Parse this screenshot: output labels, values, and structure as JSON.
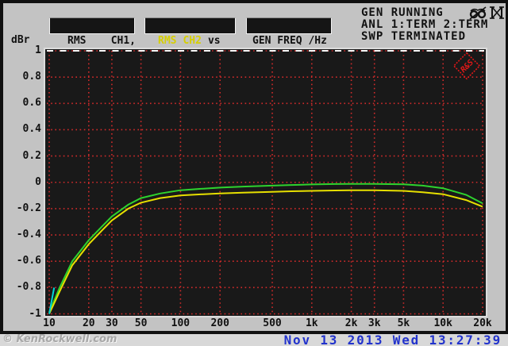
{
  "header": {
    "unit_label": "dBr",
    "meters": [
      {
        "quantity": "RMS",
        "channel": "CH1,"
      },
      {
        "quantity": "RMS",
        "channel": "CH2",
        "suffix": "vs"
      },
      {
        "label": "GEN FREQ /Hz"
      }
    ],
    "status_lines": [
      "GEN RUNNING",
      "ANL 1:TERM 2:TERM",
      "SWP TERMINATED"
    ]
  },
  "logo": {
    "text": "R&S"
  },
  "footer": {
    "watermark": "© KenRockwell.com",
    "timestamp": "Nov 13 2013 Wed 13:27:39"
  },
  "colors": {
    "ch1_trace": "#2ed32e",
    "ch2_trace": "#e6df00",
    "overlap_trace": "#00d8d8",
    "grid": "#d32b2b",
    "top_grid_dash": "#fafafa",
    "plot_bg": "#191919",
    "screen_bg": "#c3c3c3",
    "timestamp_blue": "#2233cc",
    "logo_red": "#e01818"
  },
  "chart_data": {
    "type": "line",
    "title": "",
    "xlabel": "GEN FREQ /Hz",
    "ylabel": "dBr",
    "x_scale": "log",
    "xlim": [
      10,
      20000
    ],
    "ylim": [
      -1,
      1
    ],
    "grid": "red dotted on black",
    "legend_position": "none",
    "y_ticks": [
      {
        "v": 1,
        "label": "1"
      },
      {
        "v": 0.8,
        "label": "0.8"
      },
      {
        "v": 0.6,
        "label": "0.6"
      },
      {
        "v": 0.4,
        "label": "0.4"
      },
      {
        "v": 0.2,
        "label": "0.2"
      },
      {
        "v": 0,
        "label": "0"
      },
      {
        "v": -0.2,
        "label": "-0.2"
      },
      {
        "v": -0.4,
        "label": "-0.4"
      },
      {
        "v": -0.6,
        "label": "-0.6"
      },
      {
        "v": -0.8,
        "label": "-0.8"
      },
      {
        "v": -1,
        "label": "-1"
      }
    ],
    "x_ticks": [
      {
        "f": 10,
        "label": "10"
      },
      {
        "f": 20,
        "label": "20"
      },
      {
        "f": 30,
        "label": "30"
      },
      {
        "f": 50,
        "label": "50"
      },
      {
        "f": 100,
        "label": "100"
      },
      {
        "f": 200,
        "label": "200"
      },
      {
        "f": 500,
        "label": "500"
      },
      {
        "f": 1000,
        "label": "1k"
      },
      {
        "f": 2000,
        "label": "2k"
      },
      {
        "f": 3000,
        "label": "3k"
      },
      {
        "f": 5000,
        "label": "5k"
      },
      {
        "f": 10000,
        "label": "10k"
      },
      {
        "f": 20000,
        "label": "20k"
      }
    ],
    "x": [
      10,
      12,
      15,
      20,
      25,
      30,
      40,
      50,
      70,
      100,
      150,
      200,
      300,
      500,
      700,
      1000,
      1500,
      2000,
      3000,
      5000,
      7000,
      10000,
      15000,
      20000
    ],
    "series": [
      {
        "name": "RMS CH1",
        "color": "#2ed32e",
        "y": [
          -0.99,
          -0.8,
          -0.6,
          -0.44,
          -0.34,
          -0.26,
          -0.17,
          -0.12,
          -0.085,
          -0.06,
          -0.048,
          -0.04,
          -0.032,
          -0.025,
          -0.02,
          -0.016,
          -0.013,
          -0.012,
          -0.012,
          -0.015,
          -0.025,
          -0.045,
          -0.095,
          -0.16
        ]
      },
      {
        "name": "RMS CH2",
        "color": "#e6df00",
        "y": [
          -1.0,
          -0.83,
          -0.63,
          -0.47,
          -0.37,
          -0.29,
          -0.2,
          -0.155,
          -0.12,
          -0.1,
          -0.09,
          -0.085,
          -0.078,
          -0.072,
          -0.068,
          -0.065,
          -0.062,
          -0.06,
          -0.06,
          -0.065,
          -0.075,
          -0.09,
          -0.135,
          -0.185
        ]
      },
      {
        "name": "trace-overlap-segment",
        "color": "#00d8d8",
        "x": [
          10,
          10.9
        ],
        "y": [
          -1.0,
          -0.8
        ]
      }
    ]
  }
}
